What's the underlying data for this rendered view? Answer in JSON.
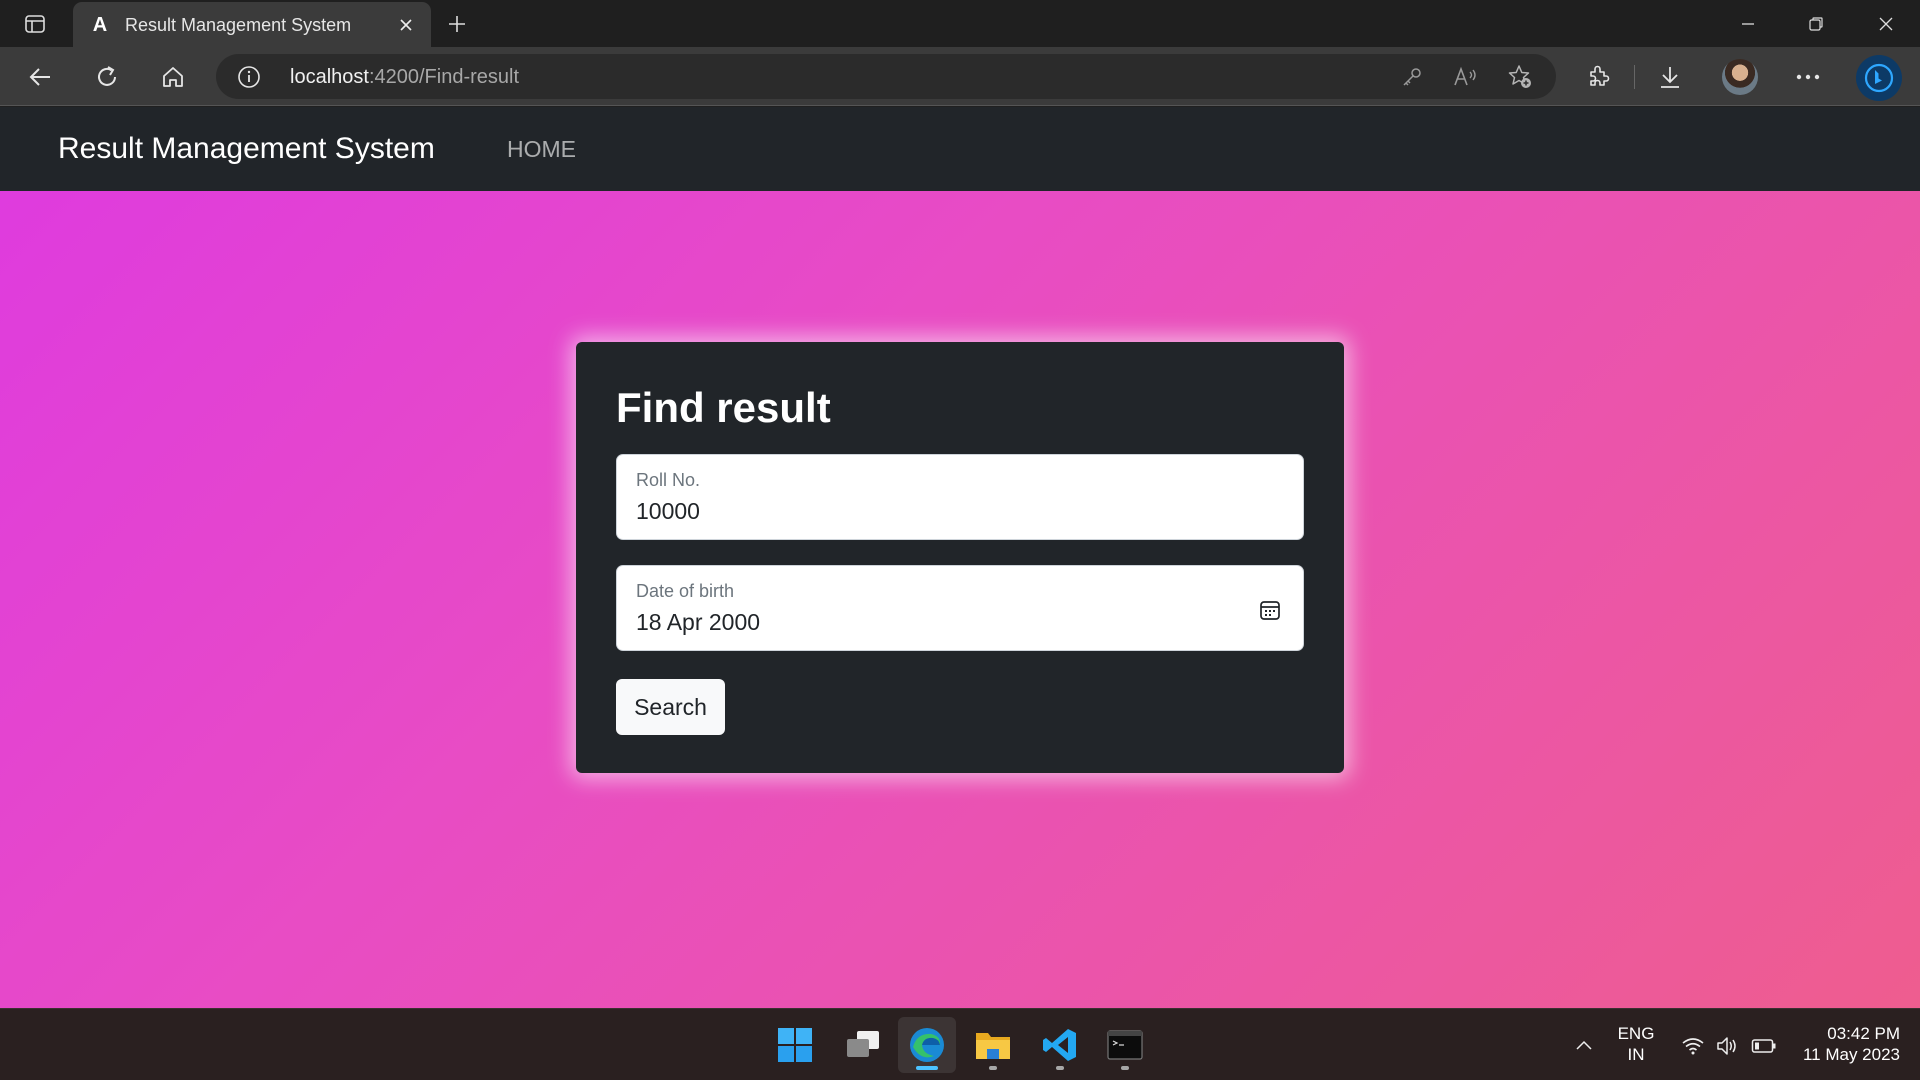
{
  "browser": {
    "tab_title": "Result Management System",
    "url_host": "localhost",
    "url_rest": ":4200/Find-result"
  },
  "app": {
    "brand": "Result Management System",
    "nav_items": [
      {
        "label": "HOME"
      }
    ]
  },
  "find_result": {
    "title": "Find result",
    "roll_no": {
      "label": "Roll No.",
      "value": "10000"
    },
    "dob": {
      "label": "Date of birth",
      "value": "18 Apr 2000"
    },
    "search_label": "Search"
  },
  "taskbar": {
    "apps": [
      {
        "name": "start",
        "icon": "windows-logo-icon"
      },
      {
        "name": "task-view",
        "icon": "task-view-icon"
      },
      {
        "name": "edge",
        "icon": "edge-icon",
        "running": true,
        "focused": true
      },
      {
        "name": "file-explorer",
        "icon": "folder-icon",
        "running": true
      },
      {
        "name": "vscode",
        "icon": "vscode-icon",
        "running": true
      },
      {
        "name": "terminal",
        "icon": "terminal-icon",
        "running": true
      }
    ],
    "lang_line1": "ENG",
    "lang_line2": "IN",
    "time": "03:42 PM",
    "date": "11 May 2023"
  },
  "colors": {
    "accent_blue": "#4cc2ff",
    "navbar_bg": "#212529",
    "gradient_start": "#de3ae0",
    "gradient_end": "#ee5d8f"
  }
}
